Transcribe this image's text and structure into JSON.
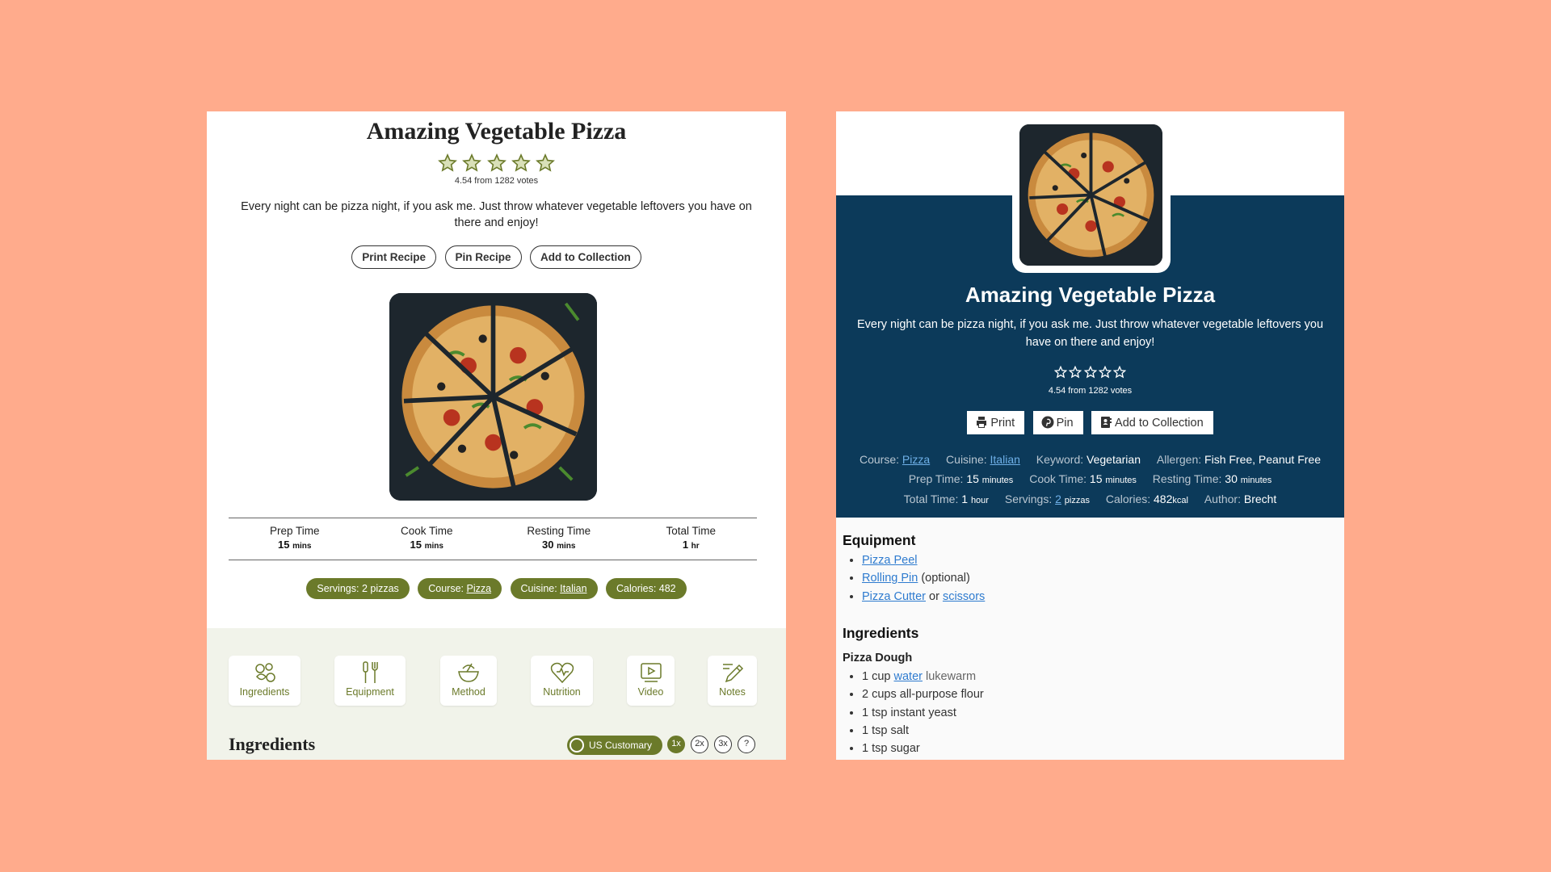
{
  "left": {
    "title": "Amazing Vegetable Pizza",
    "rating_text": "4.54 from 1282 votes",
    "summary": "Every night can be pizza night, if you ask me. Just throw whatever vegetable leftovers you have on there and enjoy!",
    "buttons": [
      "Print Recipe",
      "Pin Recipe",
      "Add to Collection"
    ],
    "times": [
      {
        "label": "Prep Time",
        "value": "15",
        "unit": "mins"
      },
      {
        "label": "Cook Time",
        "value": "15",
        "unit": "mins"
      },
      {
        "label": "Resting Time",
        "value": "30",
        "unit": "mins"
      },
      {
        "label": "Total Time",
        "value": "1",
        "unit": "hr"
      }
    ],
    "badges": {
      "servings": "Servings: 2 pizzas",
      "course_label": "Course: ",
      "course_value": "Pizza",
      "cuisine_label": "Cuisine: ",
      "cuisine_value": "Italian",
      "calories": "Calories: 482"
    },
    "tabs": [
      "Ingredients",
      "Equipment",
      "Method",
      "Nutrition",
      "Video",
      "Notes"
    ],
    "ingredients_heading": "Ingredients",
    "unit_toggle": "US Customary",
    "multipliers": [
      "1x",
      "2x",
      "3x",
      "?"
    ],
    "accent_color": "#6b7a2a"
  },
  "right": {
    "title": "Amazing Vegetable Pizza",
    "summary": "Every night can be pizza night, if you ask me. Just throw whatever vegetable leftovers you have on there and enjoy!",
    "rating_text": "4.54 from 1282 votes",
    "buttons": {
      "print": "Print",
      "pin": "Pin",
      "collection": "Add to Collection"
    },
    "meta": {
      "course_k": "Course:",
      "course_v": "Pizza",
      "cuisine_k": "Cuisine:",
      "cuisine_v": "Italian",
      "keyword_k": "Keyword:",
      "keyword_v": "Vegetarian",
      "allergen_k": "Allergen:",
      "allergen_v": "Fish Free, Peanut Free",
      "prep_k": "Prep Time:",
      "prep_v": "15",
      "prep_u": "minutes",
      "cook_k": "Cook Time:",
      "cook_v": "15",
      "cook_u": "minutes",
      "rest_k": "Resting Time:",
      "rest_v": "30",
      "rest_u": "minutes",
      "total_k": "Total Time:",
      "total_v": "1",
      "total_u": "hour",
      "serv_k": "Servings:",
      "serv_v": "2",
      "serv_u": "pizzas",
      "cal_k": "Calories:",
      "cal_v": "482",
      "cal_u": "kcal",
      "author_k": "Author:",
      "author_v": "Brecht"
    },
    "equipment_heading": "Equipment",
    "equipment": {
      "peel": "Pizza Peel",
      "rolling": "Rolling Pin",
      "rolling_note": " (optional)",
      "cutter": "Pizza Cutter",
      "or": " or ",
      "scissors": "scissors"
    },
    "ingredients_heading": "Ingredients",
    "dough_heading": "Pizza Dough",
    "ingredients": {
      "water_amt": "1 cup ",
      "water": "water",
      "water_note": " lukewarm",
      "flour": "2 cups all-purpose flour",
      "yeast": "1 tsp instant yeast",
      "salt": "1 tsp salt",
      "sugar": "1 tsp sugar"
    },
    "banner_color": "#0c3a5a"
  },
  "background_color": "#ffab8c"
}
